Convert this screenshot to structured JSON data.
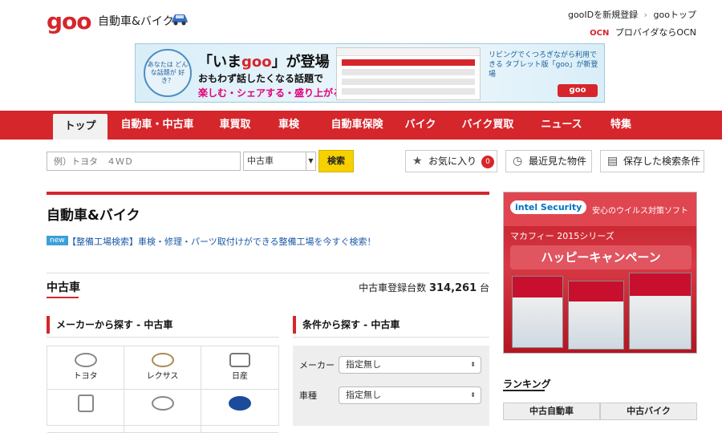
{
  "header": {
    "logo": "goo",
    "subtitle": "自動車&バイク",
    "links": {
      "register": "gooIDを新規登録",
      "top": "gooトップ"
    },
    "ocn": {
      "logo": "OCN",
      "text": "プロバイダならOCN"
    }
  },
  "banner": {
    "bubble": "あなたは どんな話題が 好き？",
    "headline_pre": "「いま",
    "headline_goo": "goo",
    "headline_post": "」が登場",
    "line2": "おもわず話したくなる話題で",
    "line3": "楽しむ・シェアする・盛り上がる！",
    "right_text": "リビングでくつろぎながら利用できる タブレット版「goo」が新登場",
    "tag": "goo"
  },
  "nav": {
    "items": [
      {
        "label": "トップ",
        "active": true
      },
      {
        "label": "自動車・中古車"
      },
      {
        "label": "車買取"
      },
      {
        "label": "車検"
      },
      {
        "label": "自動車保険"
      },
      {
        "label": "バイク"
      },
      {
        "label": "バイク買取"
      },
      {
        "label": "ニュース"
      },
      {
        "label": "特集"
      }
    ]
  },
  "search": {
    "placeholder": "例）トヨタ　４ＷＤ",
    "category": "中古車",
    "button": "検索",
    "favorites": "お気に入り",
    "favorites_count": "0",
    "recent": "最近見た物件",
    "saved": "保存した検索条件"
  },
  "main": {
    "title": "自動車&バイク",
    "new_tag": "new",
    "new_link": "【整備工場検索】車検・修理・パーツ取付けができる整備工場を今すぐ検索！",
    "section_title": "中古車",
    "count_label": "中古車登録台数",
    "count_value": "314,261",
    "count_unit": "台",
    "maker_heading": "メーカーから探す - 中古車",
    "cond_heading": "条件から探す - 中古車",
    "makers": [
      {
        "name": "トヨタ"
      },
      {
        "name": "レクサス"
      },
      {
        "name": "日産"
      },
      {
        "name": ""
      },
      {
        "name": ""
      },
      {
        "name": ""
      }
    ],
    "conditions": [
      {
        "label": "メーカー",
        "value": "指定無し"
      },
      {
        "label": "車種",
        "value": "指定無し"
      }
    ]
  },
  "ad": {
    "brand": "intel Security",
    "top_text": "安心のウイルス対策ソフト",
    "series": "マカフィー 2015シリーズ",
    "campaign": "ハッピーキャンペーン"
  },
  "ranking": {
    "heading": "ランキング",
    "tabs": [
      "中古自動車",
      "中古バイク"
    ]
  },
  "colors": {
    "brand_red": "#d5262c",
    "search_yellow": "#f7d000",
    "link_blue": "#1a5aa8"
  }
}
